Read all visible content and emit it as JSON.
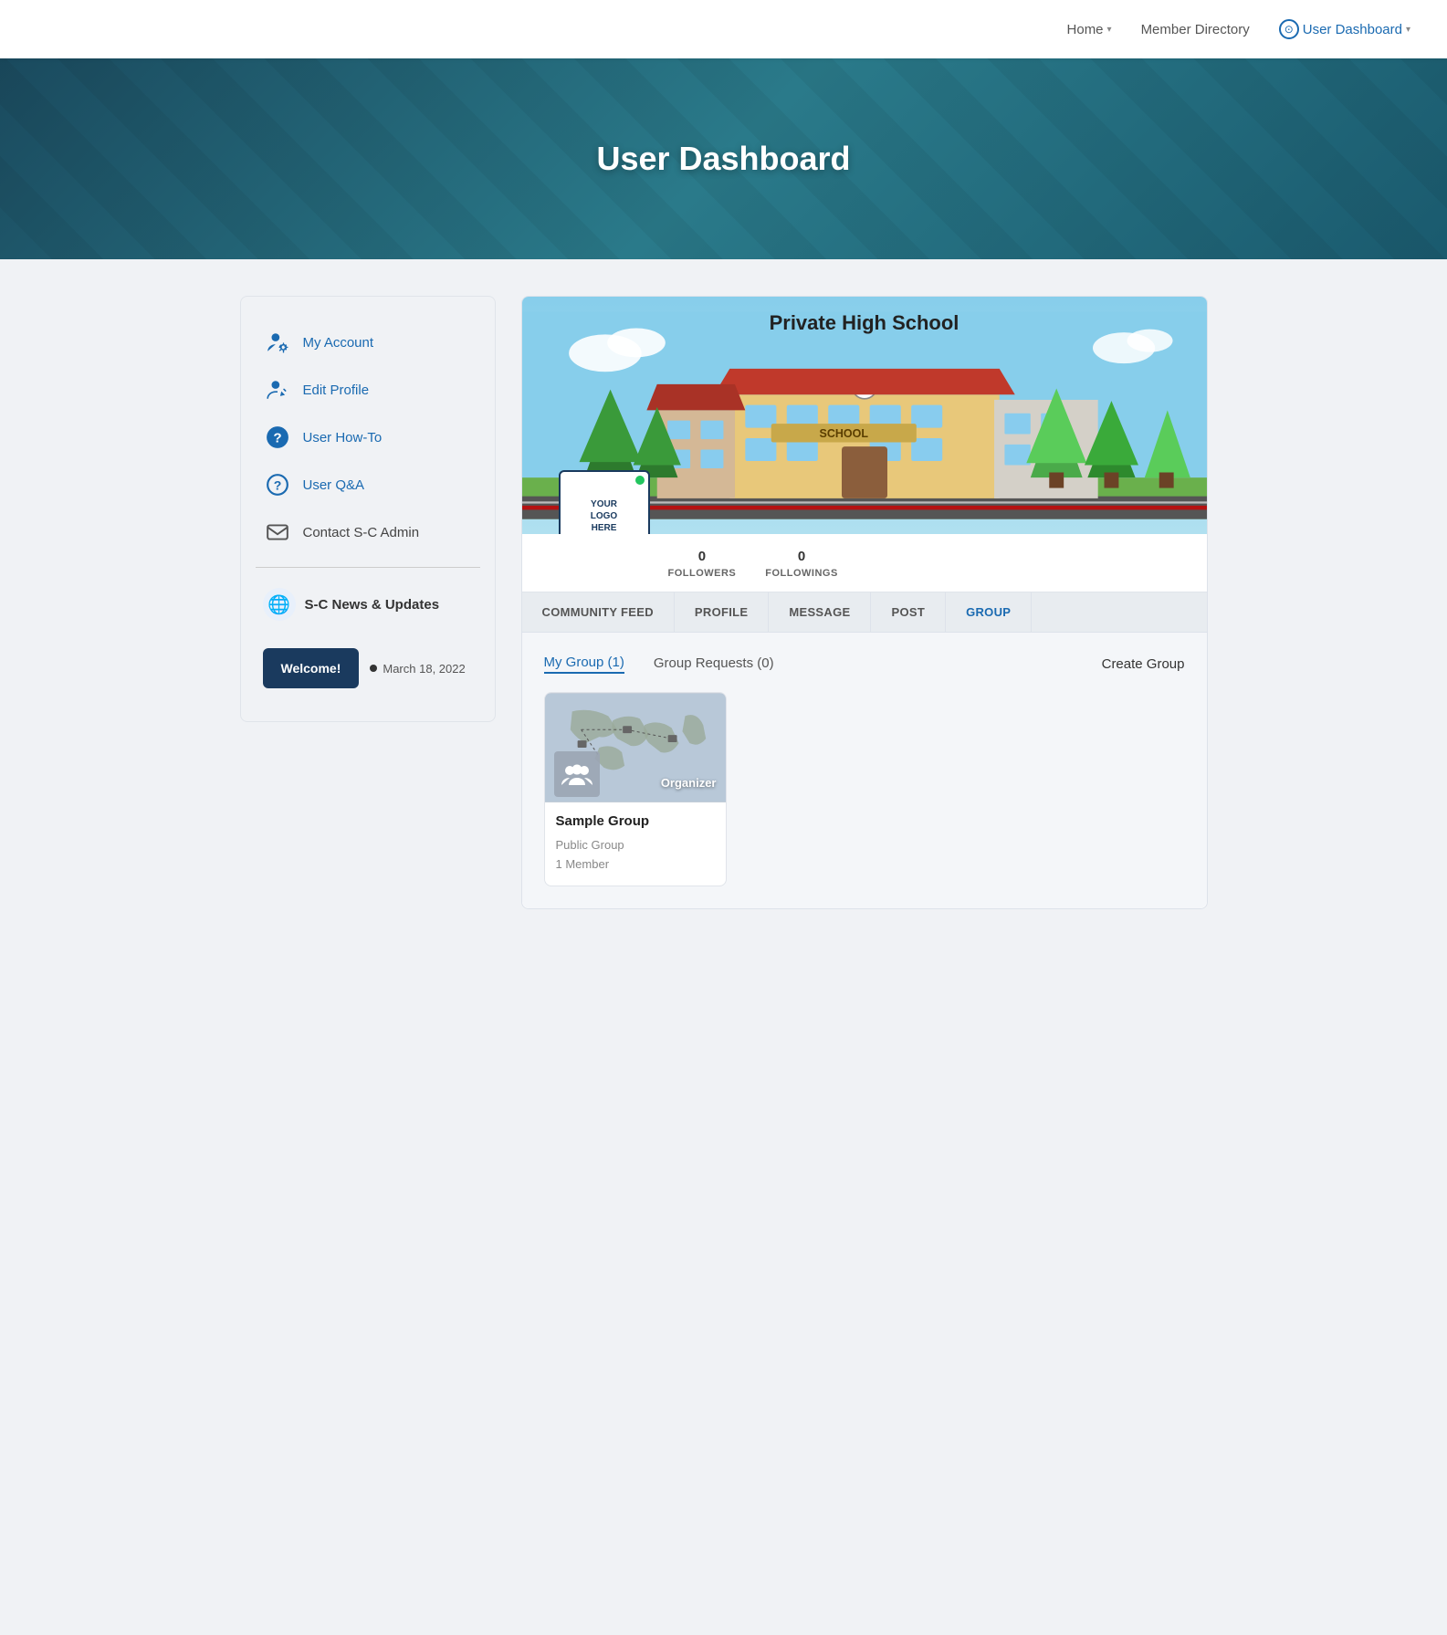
{
  "navbar": {
    "links": [
      {
        "label": "Home",
        "hasChevron": true,
        "active": false
      },
      {
        "label": "Member Directory",
        "hasChevron": false,
        "active": false
      },
      {
        "label": "User Dashboard",
        "hasChevron": true,
        "active": true,
        "hasUserIcon": true
      }
    ]
  },
  "hero": {
    "title": "User Dashboard"
  },
  "sidebar": {
    "nav_items": [
      {
        "label": "My Account",
        "icon": "person-gear",
        "color": "blue"
      },
      {
        "label": "Edit Profile",
        "icon": "person-edit",
        "color": "blue"
      },
      {
        "label": "User How-To",
        "icon": "question-circle-solid",
        "color": "blue"
      },
      {
        "label": "User Q&A",
        "icon": "question-circle-outline",
        "color": "blue"
      },
      {
        "label": "Contact S-C Admin",
        "icon": "envelope",
        "color": "dark"
      }
    ],
    "news_label": "S-C News & Updates",
    "welcome": {
      "button_label": "Welcome!",
      "date": "March 18, 2022"
    }
  },
  "profile": {
    "school_name": "Private High School",
    "logo_lines": [
      "YOUR",
      "LOGO",
      "HERE"
    ],
    "followers": 0,
    "followings": 0,
    "followers_label": "FOLLOWERS",
    "followings_label": "FOLLOWINGS"
  },
  "tabs": [
    {
      "label": "COMMUNITY FEED",
      "active": false
    },
    {
      "label": "PROFILE",
      "active": false
    },
    {
      "label": "MESSAGE",
      "active": false
    },
    {
      "label": "POST",
      "active": false
    },
    {
      "label": "GROUP",
      "active": true
    }
  ],
  "group_tab": {
    "subtabs": [
      {
        "label": "My Group (1)",
        "active": true
      },
      {
        "label": "Group Requests (0)",
        "active": false
      }
    ],
    "create_label": "Create Group",
    "group_card": {
      "organizer_label": "Organizer",
      "group_name": "Sample Group",
      "group_type": "Public Group",
      "member_count": "1 Member"
    }
  }
}
